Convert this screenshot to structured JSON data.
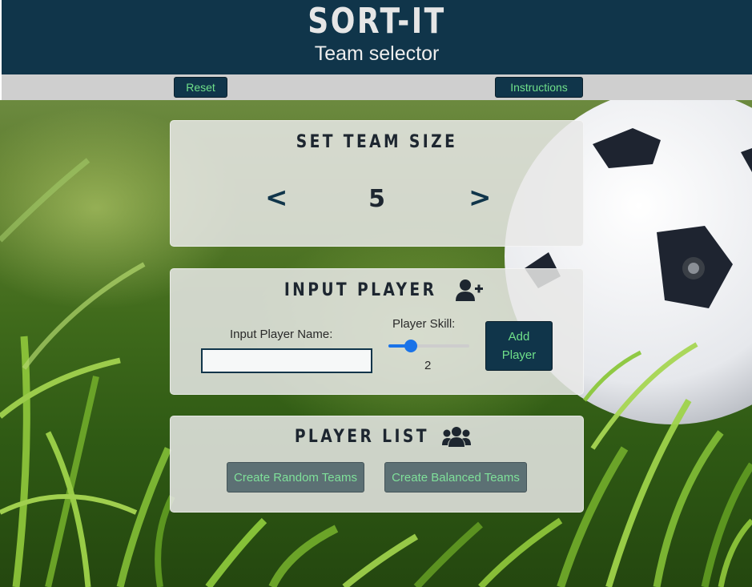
{
  "header": {
    "logo": "SORT-IT",
    "subtitle": "Team selector"
  },
  "nav": {
    "reset_label": "Reset",
    "instructions_label": "Instructions"
  },
  "team_size": {
    "title": "SET TEAM SIZE",
    "decrease_label": "<",
    "increase_label": ">",
    "value": "5"
  },
  "input_player": {
    "title": "INPUT PLAYER",
    "title_icon": "user-plus-icon",
    "name_label": "Input Player Name:",
    "name_value": "",
    "skill_label": "Player Skill:",
    "skill_value": "2",
    "skill_fraction": 0.28,
    "add_label_line1": "Add",
    "add_label_line2": "Player"
  },
  "player_list": {
    "title": "PLAYER LIST",
    "title_icon": "users-icon",
    "random_label": "Create Random Teams",
    "balanced_label": "Create Balanced Teams"
  },
  "colors": {
    "header_bg": "#10354a",
    "button_text": "#6fe08a",
    "slider_accent": "#1a73e8",
    "muted_button": "#5c7074"
  }
}
